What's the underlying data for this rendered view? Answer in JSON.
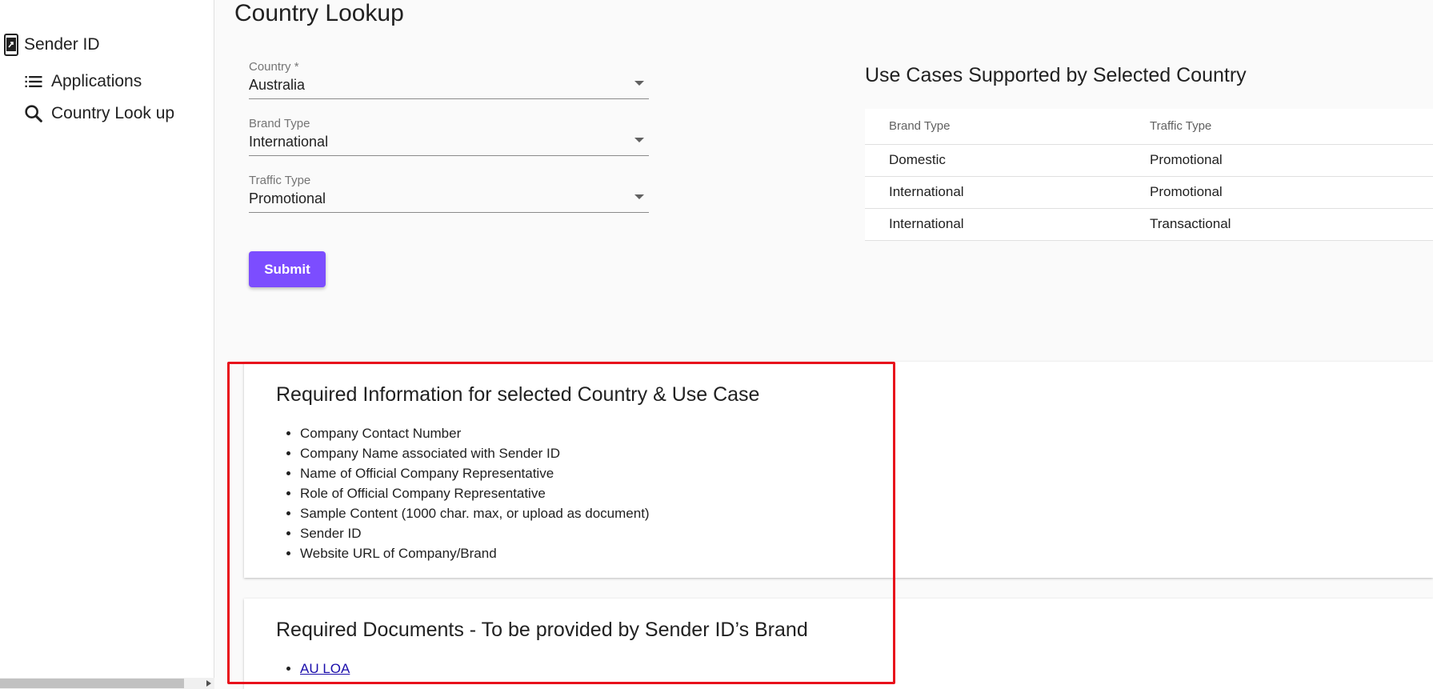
{
  "sidebar": {
    "title": "Sender ID",
    "items": [
      {
        "label": "Applications",
        "icon": "list-icon"
      },
      {
        "label": "Country Look up",
        "icon": "search-icon"
      }
    ]
  },
  "page": {
    "title": "Country Lookup"
  },
  "form": {
    "country": {
      "label": "Country *",
      "value": "Australia"
    },
    "brand_type": {
      "label": "Brand Type",
      "value": "International"
    },
    "traffic_type": {
      "label": "Traffic Type",
      "value": "Promotional"
    },
    "submit_label": "Submit"
  },
  "use_cases": {
    "title": "Use Cases Supported by Selected Country",
    "columns": [
      "Brand Type",
      "Traffic Type"
    ],
    "rows": [
      [
        "Domestic",
        "Promotional"
      ],
      [
        "International",
        "Promotional"
      ],
      [
        "International",
        "Transactional"
      ]
    ]
  },
  "required_info": {
    "title": "Required Information for selected Country & Use Case",
    "items": [
      "Company Contact Number",
      "Company Name associated with Sender ID",
      "Name of Official Company Representative",
      "Role of Official Company Representative",
      "Sample Content (1000 char. max, or upload as document)",
      "Sender ID",
      "Website URL of Company/Brand"
    ]
  },
  "required_docs": {
    "title": "Required Documents - To be provided by Sender ID’s Brand",
    "items": [
      "AU LOA"
    ]
  },
  "colors": {
    "accent": "#7c4dff",
    "highlight": "#e8111b",
    "link": "#1a0dab"
  }
}
